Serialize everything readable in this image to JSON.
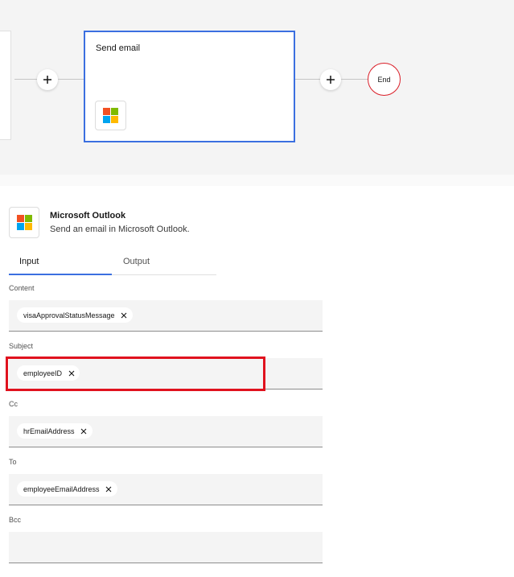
{
  "flow": {
    "node": {
      "title": "Send email",
      "icon": "microsoft-logo-icon"
    },
    "end_label": "End",
    "add_icon": "plus-icon",
    "colors": {
      "canvas_bg": "#f4f4f4",
      "selected_border": "#3b6fe0",
      "end_border": "#da1e28"
    }
  },
  "panel": {
    "app_name": "Microsoft Outlook",
    "app_description": "Send an email in Microsoft Outlook.",
    "app_icon": "microsoft-logo-icon",
    "tabs": [
      {
        "label": "Input",
        "selected": true
      },
      {
        "label": "Output",
        "selected": false
      }
    ],
    "fields": {
      "content": {
        "label": "Content",
        "chip": "visaApprovalStatusMessage"
      },
      "subject": {
        "label": "Subject",
        "chip": "employeeID"
      },
      "cc": {
        "label": "Cc",
        "chip": "hrEmailAddress"
      },
      "to": {
        "label": "To",
        "chip": "employeeEmailAddress"
      },
      "bcc": {
        "label": "Bcc",
        "chip": ""
      }
    },
    "chip_remove_icon": "close-icon"
  },
  "annotation": {
    "highlight_color": "#e0121e"
  },
  "microsoft_logo_colors": [
    "#f25022",
    "#7fba00",
    "#00a4ef",
    "#ffb900"
  ]
}
